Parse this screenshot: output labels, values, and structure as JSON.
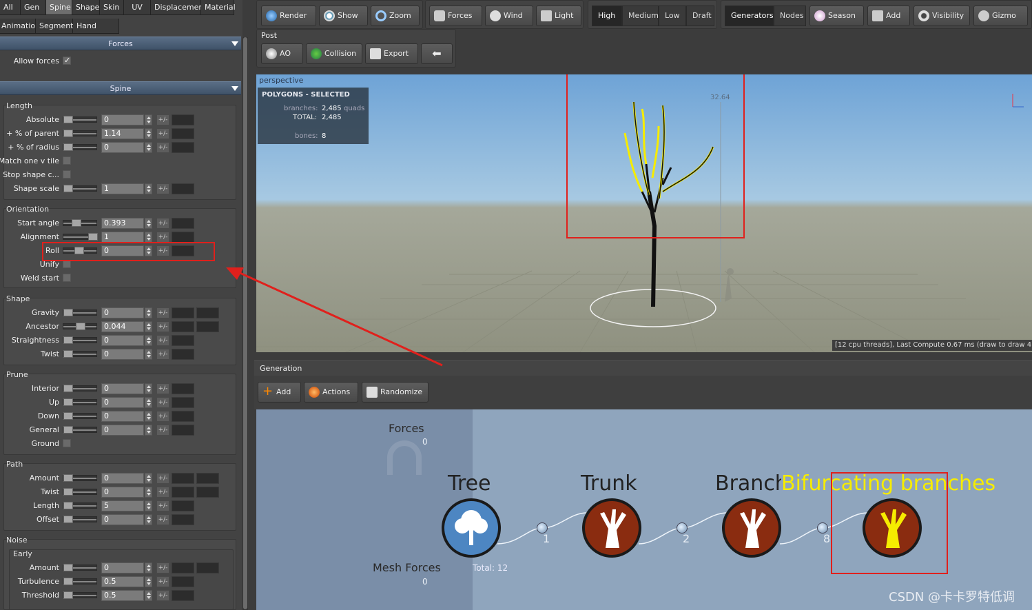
{
  "top_tabs": [
    "All",
    "Gen",
    "Spine",
    "Shape",
    "Skin",
    "UV",
    "Displacement",
    "Material"
  ],
  "sub_tabs": [
    "Animation",
    "Segments",
    "Hand Drawn"
  ],
  "forces_section": {
    "title": "Forces",
    "allow_forces_label": "Allow forces",
    "allow_forces_checked": true
  },
  "spine_section": {
    "title": "Spine"
  },
  "length_group": {
    "title": "Length",
    "rows": [
      {
        "label": "Absolute",
        "value": "0"
      },
      {
        "label": "+ % of parent",
        "value": "1.14"
      },
      {
        "label": "+ % of radius",
        "value": "0"
      },
      {
        "label": "Match one v tile",
        "checkbox": true
      },
      {
        "label": "Stop shape c...",
        "checkbox": true
      },
      {
        "label": "Shape scale",
        "value": "1"
      }
    ]
  },
  "orientation_group": {
    "title": "Orientation",
    "rows": [
      {
        "label": "Start angle",
        "value": "0.393"
      },
      {
        "label": "Alignment",
        "value": "1"
      },
      {
        "label": "Roll",
        "value": "0"
      },
      {
        "label": "Unify",
        "checkbox": true
      },
      {
        "label": "Weld start",
        "checkbox": true
      }
    ]
  },
  "shape_group": {
    "title": "Shape",
    "rows": [
      {
        "label": "Gravity",
        "value": "0"
      },
      {
        "label": "Ancestor",
        "value": "0.044"
      },
      {
        "label": "Straightness",
        "value": "0"
      },
      {
        "label": "Twist",
        "value": "0"
      }
    ]
  },
  "prune_group": {
    "title": "Prune",
    "rows": [
      {
        "label": "Interior",
        "value": "0"
      },
      {
        "label": "Up",
        "value": "0"
      },
      {
        "label": "Down",
        "value": "0"
      },
      {
        "label": "General",
        "value": "0"
      },
      {
        "label": "Ground",
        "checkbox": true
      }
    ]
  },
  "path_group": {
    "title": "Path",
    "rows": [
      {
        "label": "Amount",
        "value": "0"
      },
      {
        "label": "Twist",
        "value": "0"
      },
      {
        "label": "Length",
        "value": "5"
      },
      {
        "label": "Offset",
        "value": "0"
      }
    ]
  },
  "noise_group": {
    "title": "Noise",
    "subtitle": "Early",
    "rows": [
      {
        "label": "Amount",
        "value": "0"
      },
      {
        "label": "Turbulence",
        "value": "0.5"
      },
      {
        "label": "Threshold",
        "value": "0.5"
      }
    ]
  },
  "toolbar": {
    "view_buttons": [
      "Render",
      "Show",
      "Zoom"
    ],
    "scene_buttons": [
      "Forces",
      "Wind",
      "Light"
    ],
    "resolution": [
      "High",
      "Medium",
      "Low",
      "Draft"
    ],
    "resolution_active": "High",
    "edit_tabs": [
      "Generators",
      "Nodes"
    ],
    "edit_buttons": [
      "Season",
      "Add",
      "Visibility",
      "Gizmo"
    ],
    "post_label": "Post",
    "post_buttons": [
      "AO",
      "Collision",
      "Export"
    ]
  },
  "viewport": {
    "camera_label": "perspective",
    "info_title": "POLYGONS - SELECTED",
    "branches_label": "branches:",
    "branches_value": "2,485",
    "branches_unit": "quads",
    "total_label": "TOTAL:",
    "total_value": "2,485",
    "bones_label": "bones:",
    "bones_value": "8",
    "height_marker": "32.64",
    "status": "[12 cpu threads], Last Compute 0.67 ms (draw to draw 4"
  },
  "generation": {
    "title": "Generation",
    "buttons": [
      "Add",
      "Actions",
      "Randomize"
    ],
    "forces_label": "Forces",
    "forces_count": "0",
    "mesh_forces_label": "Mesh Forces",
    "mesh_forces_count": "0",
    "total_label": "Total: 12",
    "nodes": [
      {
        "title": "Tree"
      },
      {
        "title": "Trunk"
      },
      {
        "title": "Branch"
      },
      {
        "title": "Bifurcating branches"
      }
    ],
    "ports": [
      "1",
      "2",
      "8"
    ]
  },
  "watermark": "CSDN @卡卡罗特低调",
  "colors": {
    "highlight": "#f6ec00",
    "annotation": "#e0201c",
    "node_fill": "#8a2c10"
  }
}
